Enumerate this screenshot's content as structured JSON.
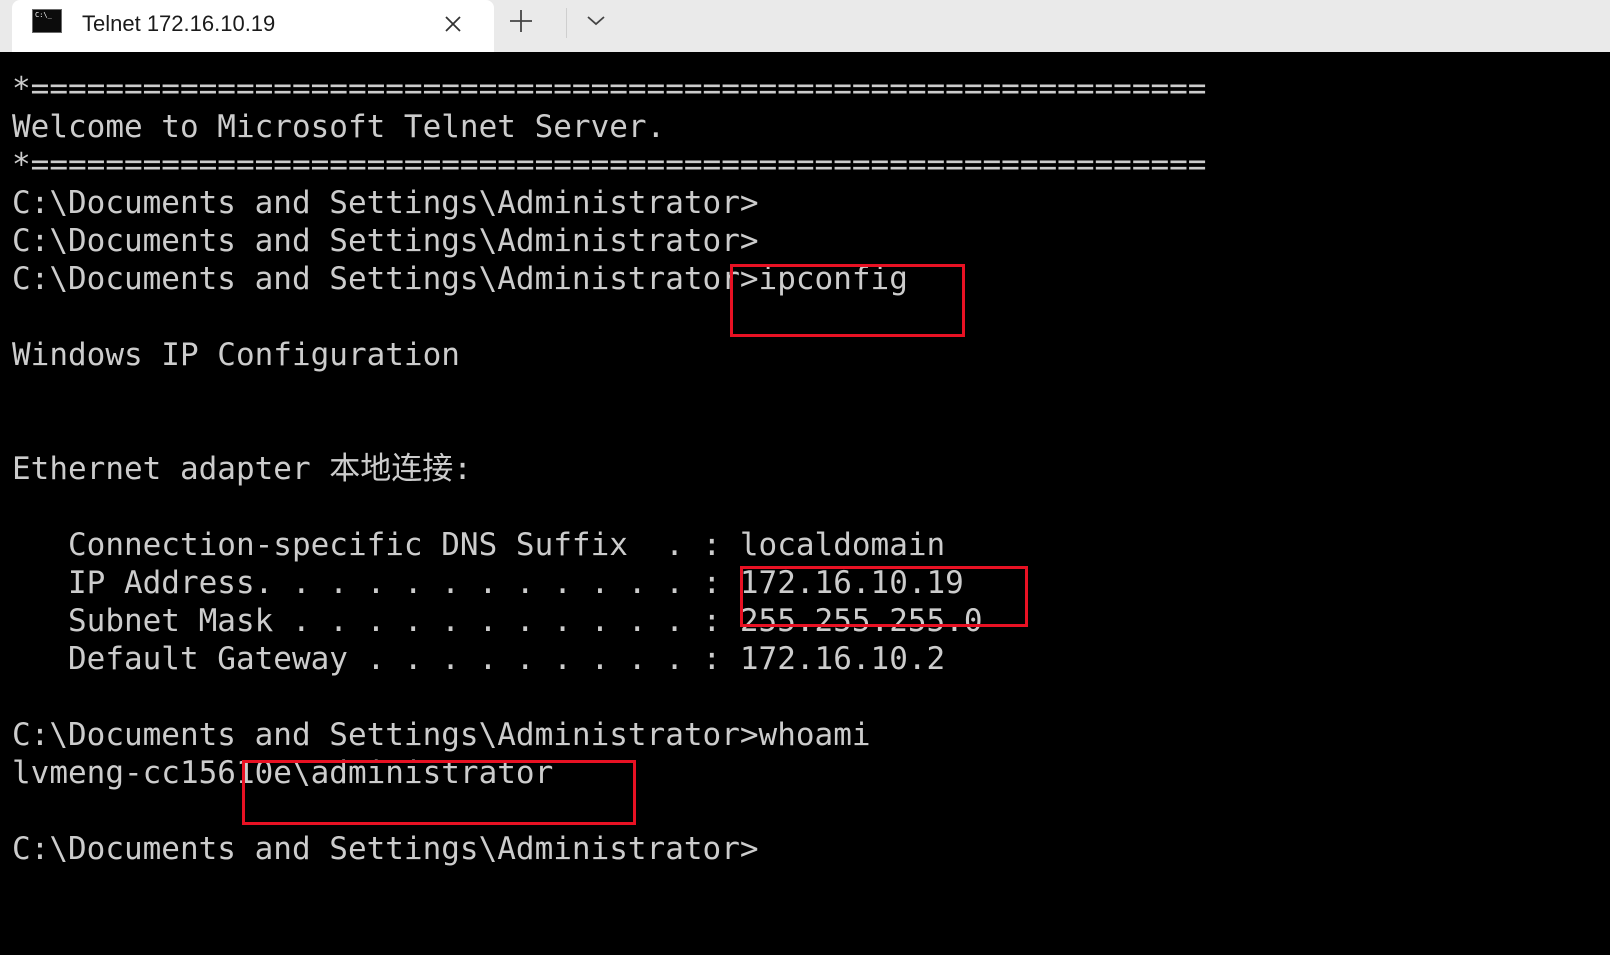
{
  "window": {
    "tab": {
      "title": "Telnet 172.16.10.19",
      "icon": "cmd-terminal-icon",
      "icon_glyph": "C:\\_"
    },
    "buttons": {
      "close_icon": "close-icon",
      "new_tab_icon": "plus-icon",
      "dropdown_icon": "chevron-down-icon"
    }
  },
  "terminal": {
    "lines": [
      "*===============================================================",
      "Welcome to Microsoft Telnet Server.",
      "*===============================================================",
      "C:\\Documents and Settings\\Administrator>",
      "C:\\Documents and Settings\\Administrator>",
      "C:\\Documents and Settings\\Administrator>ipconfig",
      "",
      "Windows IP Configuration",
      "",
      "",
      "Ethernet adapter 本地连接:",
      "",
      "   Connection-specific DNS Suffix  . : localdomain",
      "   IP Address. . . . . . . . . . . . : 172.16.10.19",
      "   Subnet Mask . . . . . . . . . . . : 255.255.255.0",
      "   Default Gateway . . . . . . . . . : 172.16.10.2",
      "",
      "C:\\Documents and Settings\\Administrator>whoami",
      "lvmeng-cc15610e\\administrator",
      "",
      "C:\\Documents and Settings\\Administrator>"
    ]
  },
  "colors": {
    "terminal_background": "#000000",
    "terminal_text": "#cccccc",
    "highlight_border": "#e81123",
    "tabbar_background": "#eaeaea",
    "active_tab_background": "#ffffff"
  }
}
